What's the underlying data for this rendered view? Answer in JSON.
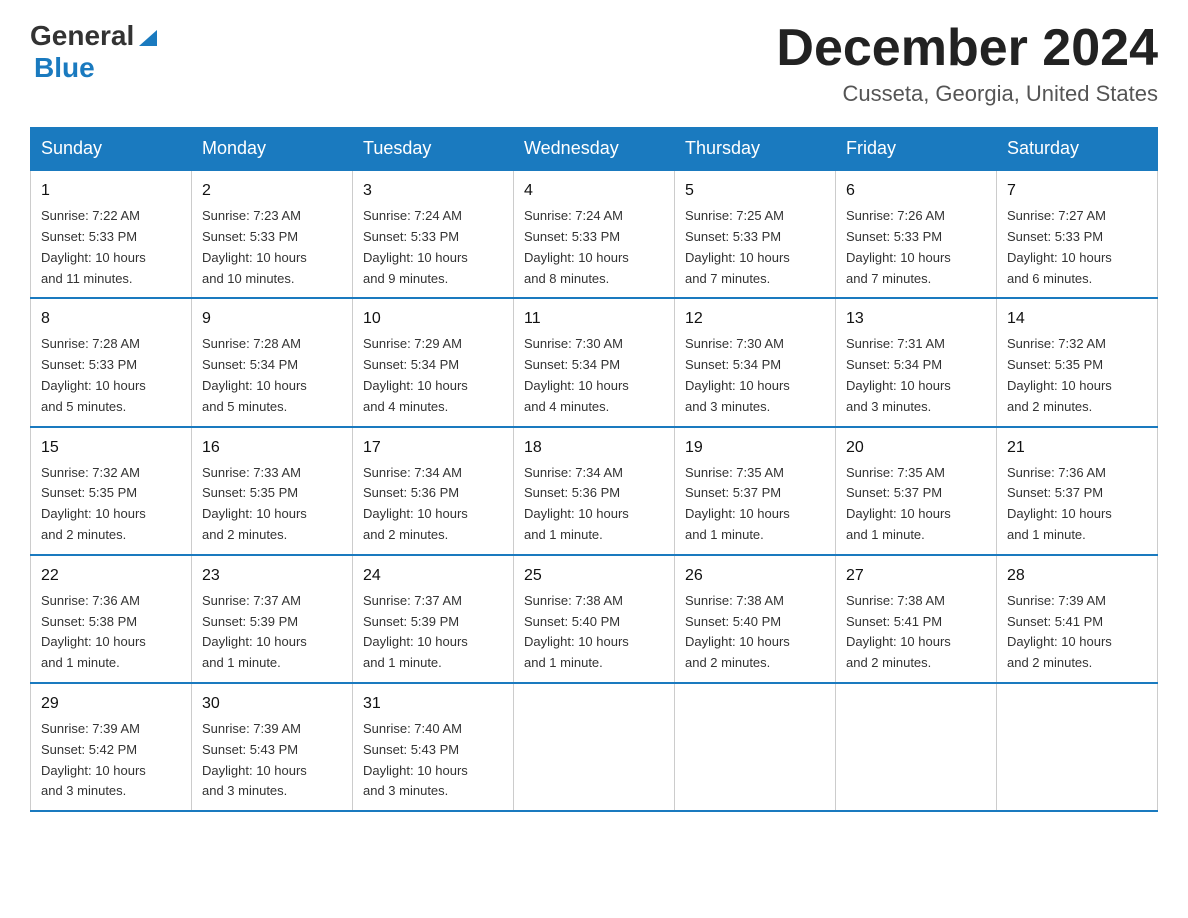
{
  "header": {
    "logo_general": "General",
    "logo_blue": "Blue",
    "month_title": "December 2024",
    "location": "Cusseta, Georgia, United States"
  },
  "weekdays": [
    "Sunday",
    "Monday",
    "Tuesday",
    "Wednesday",
    "Thursday",
    "Friday",
    "Saturday"
  ],
  "weeks": [
    [
      {
        "day": "1",
        "sunrise": "7:22 AM",
        "sunset": "5:33 PM",
        "daylight": "10 hours and 11 minutes."
      },
      {
        "day": "2",
        "sunrise": "7:23 AM",
        "sunset": "5:33 PM",
        "daylight": "10 hours and 10 minutes."
      },
      {
        "day": "3",
        "sunrise": "7:24 AM",
        "sunset": "5:33 PM",
        "daylight": "10 hours and 9 minutes."
      },
      {
        "day": "4",
        "sunrise": "7:24 AM",
        "sunset": "5:33 PM",
        "daylight": "10 hours and 8 minutes."
      },
      {
        "day": "5",
        "sunrise": "7:25 AM",
        "sunset": "5:33 PM",
        "daylight": "10 hours and 7 minutes."
      },
      {
        "day": "6",
        "sunrise": "7:26 AM",
        "sunset": "5:33 PM",
        "daylight": "10 hours and 7 minutes."
      },
      {
        "day": "7",
        "sunrise": "7:27 AM",
        "sunset": "5:33 PM",
        "daylight": "10 hours and 6 minutes."
      }
    ],
    [
      {
        "day": "8",
        "sunrise": "7:28 AM",
        "sunset": "5:33 PM",
        "daylight": "10 hours and 5 minutes."
      },
      {
        "day": "9",
        "sunrise": "7:28 AM",
        "sunset": "5:34 PM",
        "daylight": "10 hours and 5 minutes."
      },
      {
        "day": "10",
        "sunrise": "7:29 AM",
        "sunset": "5:34 PM",
        "daylight": "10 hours and 4 minutes."
      },
      {
        "day": "11",
        "sunrise": "7:30 AM",
        "sunset": "5:34 PM",
        "daylight": "10 hours and 4 minutes."
      },
      {
        "day": "12",
        "sunrise": "7:30 AM",
        "sunset": "5:34 PM",
        "daylight": "10 hours and 3 minutes."
      },
      {
        "day": "13",
        "sunrise": "7:31 AM",
        "sunset": "5:34 PM",
        "daylight": "10 hours and 3 minutes."
      },
      {
        "day": "14",
        "sunrise": "7:32 AM",
        "sunset": "5:35 PM",
        "daylight": "10 hours and 2 minutes."
      }
    ],
    [
      {
        "day": "15",
        "sunrise": "7:32 AM",
        "sunset": "5:35 PM",
        "daylight": "10 hours and 2 minutes."
      },
      {
        "day": "16",
        "sunrise": "7:33 AM",
        "sunset": "5:35 PM",
        "daylight": "10 hours and 2 minutes."
      },
      {
        "day": "17",
        "sunrise": "7:34 AM",
        "sunset": "5:36 PM",
        "daylight": "10 hours and 2 minutes."
      },
      {
        "day": "18",
        "sunrise": "7:34 AM",
        "sunset": "5:36 PM",
        "daylight": "10 hours and 1 minute."
      },
      {
        "day": "19",
        "sunrise": "7:35 AM",
        "sunset": "5:37 PM",
        "daylight": "10 hours and 1 minute."
      },
      {
        "day": "20",
        "sunrise": "7:35 AM",
        "sunset": "5:37 PM",
        "daylight": "10 hours and 1 minute."
      },
      {
        "day": "21",
        "sunrise": "7:36 AM",
        "sunset": "5:37 PM",
        "daylight": "10 hours and 1 minute."
      }
    ],
    [
      {
        "day": "22",
        "sunrise": "7:36 AM",
        "sunset": "5:38 PM",
        "daylight": "10 hours and 1 minute."
      },
      {
        "day": "23",
        "sunrise": "7:37 AM",
        "sunset": "5:39 PM",
        "daylight": "10 hours and 1 minute."
      },
      {
        "day": "24",
        "sunrise": "7:37 AM",
        "sunset": "5:39 PM",
        "daylight": "10 hours and 1 minute."
      },
      {
        "day": "25",
        "sunrise": "7:38 AM",
        "sunset": "5:40 PM",
        "daylight": "10 hours and 1 minute."
      },
      {
        "day": "26",
        "sunrise": "7:38 AM",
        "sunset": "5:40 PM",
        "daylight": "10 hours and 2 minutes."
      },
      {
        "day": "27",
        "sunrise": "7:38 AM",
        "sunset": "5:41 PM",
        "daylight": "10 hours and 2 minutes."
      },
      {
        "day": "28",
        "sunrise": "7:39 AM",
        "sunset": "5:41 PM",
        "daylight": "10 hours and 2 minutes."
      }
    ],
    [
      {
        "day": "29",
        "sunrise": "7:39 AM",
        "sunset": "5:42 PM",
        "daylight": "10 hours and 3 minutes."
      },
      {
        "day": "30",
        "sunrise": "7:39 AM",
        "sunset": "5:43 PM",
        "daylight": "10 hours and 3 minutes."
      },
      {
        "day": "31",
        "sunrise": "7:40 AM",
        "sunset": "5:43 PM",
        "daylight": "10 hours and 3 minutes."
      },
      null,
      null,
      null,
      null
    ]
  ],
  "labels": {
    "sunrise": "Sunrise:",
    "sunset": "Sunset:",
    "daylight": "Daylight:"
  }
}
